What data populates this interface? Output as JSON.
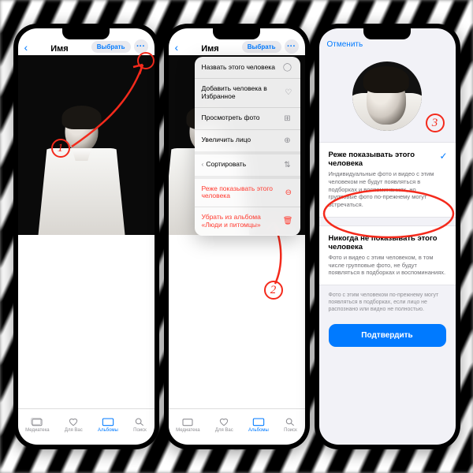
{
  "colors": {
    "accent": "#007aff",
    "destructive": "#ff3b30",
    "annotation": "#f42a1c"
  },
  "annotations": {
    "step1": "1",
    "step2": "2",
    "step3": "3"
  },
  "phone1": {
    "back_icon": "‹",
    "title": "Имя",
    "select_label": "Выбрать",
    "more_icon": "···",
    "tabs": [
      {
        "label": "Медиатека"
      },
      {
        "label": "Для Вас"
      },
      {
        "label": "Альбомы"
      },
      {
        "label": "Поиск"
      }
    ]
  },
  "phone2": {
    "back_icon": "‹",
    "title": "Имя",
    "select_label": "Выбрать",
    "more_icon": "···",
    "menu": [
      {
        "label": "Назвать этого человека",
        "icon": "person"
      },
      {
        "label": "Добавить человека в Избранное",
        "icon": "heart"
      },
      {
        "label": "Просмотреть фото",
        "icon": "grid"
      },
      {
        "label": "Увеличить лицо",
        "icon": "zoom"
      },
      {
        "label": "Сортировать",
        "icon": "sort",
        "chevron": "‹"
      },
      {
        "label": "Реже показывать этого человека",
        "icon": "minus",
        "red": true
      },
      {
        "label": "Убрать из альбома «Люди и питомцы»",
        "icon": "trash",
        "red": true
      }
    ],
    "tabs": [
      {
        "label": "Медиатека"
      },
      {
        "label": "Для Вас"
      },
      {
        "label": "Альбомы"
      },
      {
        "label": "Поиск"
      }
    ]
  },
  "phone3": {
    "cancel": "Отменить",
    "option1": {
      "title": "Реже показывать этого человека",
      "desc": "Индивидуальные фото и видео с этим человеком не будут появляться в подборках и воспоминаниях, но групповые фото по-прежнему могут встречаться.",
      "checked": true
    },
    "option2": {
      "title": "Никогда не показывать этого человека",
      "desc": "Фото и видео с этим человеком, в том числе групповые фото, не будут появляться в подборках и воспоминаниях."
    },
    "footnote": "Фото с этим человеком по-прежнему могут появляться в подборках, если лицо не распознано или видно не полностью.",
    "confirm": "Подтвердить"
  }
}
